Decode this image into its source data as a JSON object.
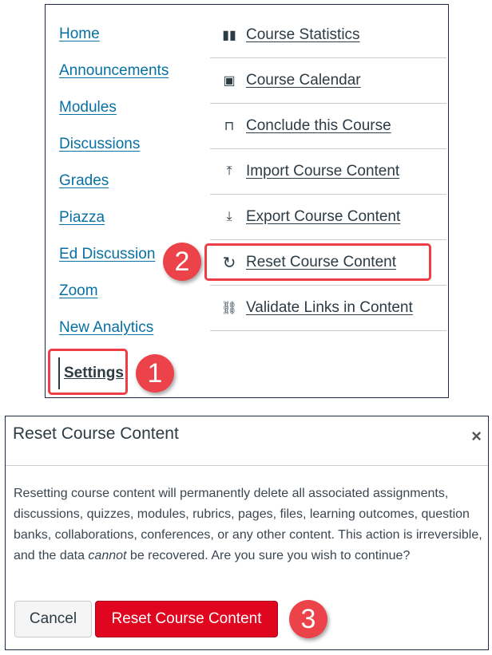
{
  "nav": [
    "Home",
    "Announcements",
    "Modules",
    "Discussions",
    "Grades",
    "Piazza",
    "Ed Discussion",
    "Zoom",
    "New Analytics"
  ],
  "settings": "Settings",
  "sidebar_actions": [
    {
      "icon": "bar-chart-icon",
      "glyph": "▮▮",
      "label": "Course Statistics"
    },
    {
      "icon": "calendar-icon",
      "glyph": "📅",
      "label": "Course Calendar"
    },
    {
      "icon": "lock-icon",
      "glyph": "🔒",
      "label": "Conclude this Course"
    },
    {
      "icon": "upload-icon",
      "glyph": "⤒",
      "label": "Import Course Content"
    },
    {
      "icon": "download-icon",
      "glyph": "⤓",
      "label": "Export Course Content"
    },
    {
      "icon": "reset-icon",
      "glyph": "↻",
      "label": "Reset Course Content"
    },
    {
      "icon": "link-icon",
      "glyph": "🔗",
      "label": "Validate Links in Content"
    }
  ],
  "badges": [
    "1",
    "2",
    "3"
  ],
  "dialog": {
    "title": "Reset Course Content",
    "close": "×",
    "body_before": "Resetting course content will permanently delete all associated assignments, discussions, quizzes, modules, rubrics, pages, files, learning outcomes, question banks, collaborations, conferences, or any other content. This action is irreversible, and the data ",
    "body_em": "cannot",
    "body_after": " be recovered. Are you sure you wish to continue?",
    "cancel": "Cancel",
    "confirm": "Reset Course Content"
  },
  "colors": {
    "link": "#0770a3",
    "highlight": "#ee3d45",
    "danger": "#e0061f"
  }
}
